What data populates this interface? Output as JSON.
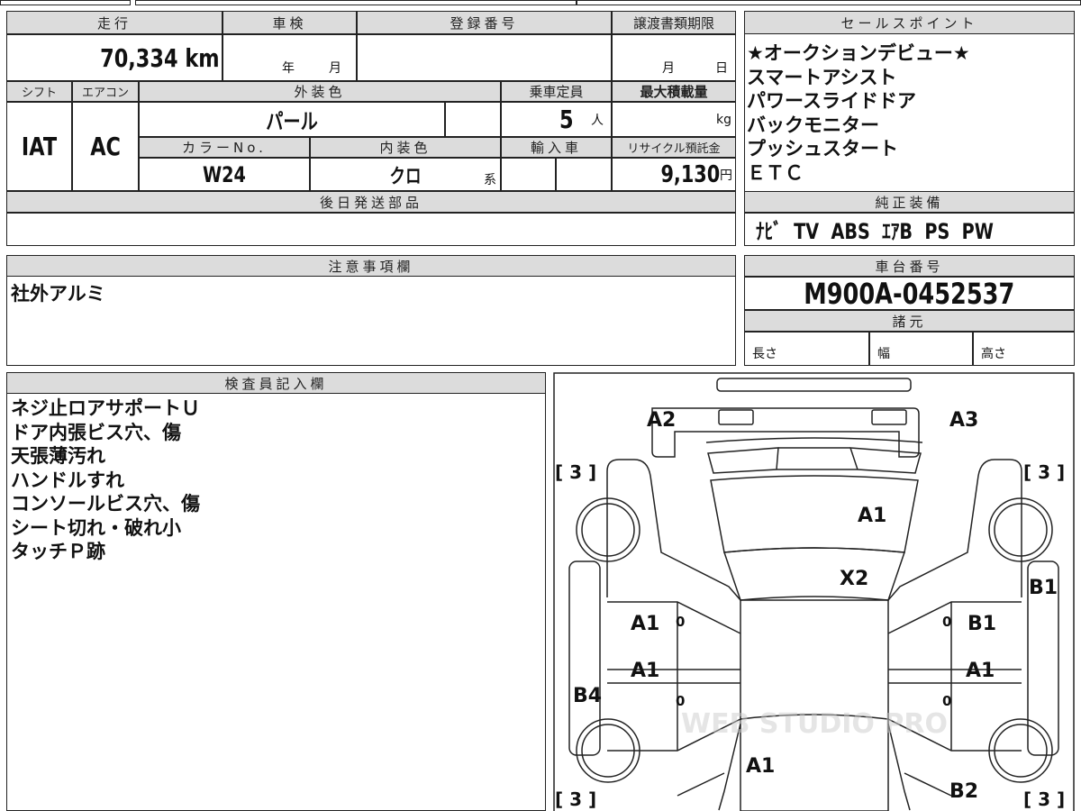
{
  "top": {
    "mileage_label": "走行",
    "mileage": "70,334 km",
    "shaken_label": "車検",
    "shaken_year": "年",
    "shaken_month": "月",
    "reg_label": "登録番号",
    "deadline_label": "譲渡書類期限",
    "deadline_month": "月",
    "deadline_day": "日",
    "shift_label": "シフト",
    "ac_label": "エアコン",
    "exterior_label": "外装色",
    "capacity_label": "乗車定員",
    "maxload_label": "最大積載量",
    "shift": "IAT",
    "ac": "AC",
    "exterior": "パール",
    "capacity": "5",
    "capacity_unit": "人",
    "maxload_unit": "kg",
    "colorno_label": "カラーNo.",
    "interior_label": "内装色",
    "import_label": "輸入車",
    "recycle_label": "リサイクル預託金",
    "colorno": "W24",
    "interior": "クロ",
    "interior_suffix": "系",
    "recycle": "9,130",
    "recycle_unit": "円",
    "later_parts_label": "後日発送部品"
  },
  "sales": {
    "label": "セールスポイント",
    "items": [
      "★オークションデビュー★",
      "スマートアシスト",
      "パワースライドドア",
      "バックモニター",
      "プッシュスタート",
      "ＥＴＣ"
    ]
  },
  "equipment": {
    "label": "純正装備",
    "value": "ﾅﾋﾞ  TV  ABS  ｴｱB  PS  PW"
  },
  "notes": {
    "label": "注意事項欄",
    "value": "社外アルミ"
  },
  "chassis": {
    "label": "車台番号",
    "value": "M900A-0452537",
    "spec_label": "諸元",
    "length": "長さ",
    "width": "幅",
    "height": "高さ"
  },
  "inspector": {
    "label": "検査員記入欄",
    "items": [
      "ネジ止ロアサポートＵ",
      "ドア内張ビス穴、傷",
      "天張薄汚れ",
      "ハンドルすれ",
      "コンソールビス穴、傷",
      "シート切れ・破れ小",
      "タッチＰ跡"
    ]
  },
  "diagram": {
    "marks": {
      "a2": "A2",
      "a3": "A3",
      "hood": "A1",
      "windshield": "X2",
      "fl_door": "A1",
      "rl_door": "A1",
      "fr_door": "B1",
      "rr_door": "A1",
      "r_sill": "B1",
      "l_sill": "B4",
      "rear": "A1",
      "rr_quarter": "B2"
    },
    "tires": [
      "[ 3 ]",
      "[ 3 ]",
      "[ 3 ]",
      "[ 3 ]"
    ],
    "zero": "0",
    "watermark": "WEB STUDIO PRO"
  }
}
